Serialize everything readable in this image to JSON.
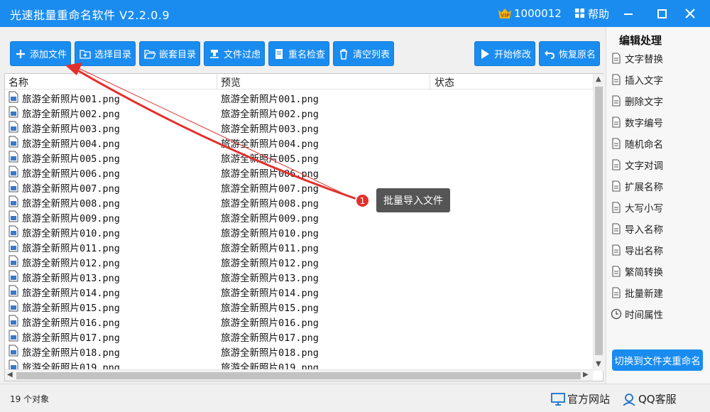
{
  "titlebar": {
    "title": "光速批量重命名软件 V2.2.0.9",
    "vip_number": "1000012",
    "help_label": "帮助"
  },
  "toolbar": {
    "add_files": "添加文件",
    "select_dir": "选择目录",
    "nested_dir": "嵌套目录",
    "file_filter": "文件过虑",
    "dup_check": "重名检查",
    "clear_list": "清空列表",
    "start": "开始修改",
    "restore": "恢复原名"
  },
  "list": {
    "columns": [
      "名称",
      "预览",
      "状态"
    ],
    "rows": [
      {
        "name": "旅游全新照片001.png",
        "preview": "旅游全新照片001.png"
      },
      {
        "name": "旅游全新照片002.png",
        "preview": "旅游全新照片002.png"
      },
      {
        "name": "旅游全新照片003.png",
        "preview": "旅游全新照片003.png"
      },
      {
        "name": "旅游全新照片004.png",
        "preview": "旅游全新照片004.png"
      },
      {
        "name": "旅游全新照片005.png",
        "preview": "旅游全新照片005.png"
      },
      {
        "name": "旅游全新照片006.png",
        "preview": "旅游全新照片006.png"
      },
      {
        "name": "旅游全新照片007.png",
        "preview": "旅游全新照片007.png"
      },
      {
        "name": "旅游全新照片008.png",
        "preview": "旅游全新照片008.png"
      },
      {
        "name": "旅游全新照片009.png",
        "preview": "旅游全新照片009.png"
      },
      {
        "name": "旅游全新照片010.png",
        "preview": "旅游全新照片010.png"
      },
      {
        "name": "旅游全新照片011.png",
        "preview": "旅游全新照片011.png"
      },
      {
        "name": "旅游全新照片012.png",
        "preview": "旅游全新照片012.png"
      },
      {
        "name": "旅游全新照片013.png",
        "preview": "旅游全新照片013.png"
      },
      {
        "name": "旅游全新照片014.png",
        "preview": "旅游全新照片014.png"
      },
      {
        "name": "旅游全新照片015.png",
        "preview": "旅游全新照片015.png"
      },
      {
        "name": "旅游全新照片016.png",
        "preview": "旅游全新照片016.png"
      },
      {
        "name": "旅游全新照片017.png",
        "preview": "旅游全新照片017.png"
      },
      {
        "name": "旅游全新照片018.png",
        "preview": "旅游全新照片018.png"
      },
      {
        "name": "旅游全新照片019.png",
        "preview": "旅游全新照片019.png"
      }
    ]
  },
  "side": {
    "title": "编辑处理",
    "items": [
      "文字替换",
      "插入文字",
      "删除文字",
      "数字编号",
      "随机命名",
      "文字对调",
      "扩展名称",
      "大写小写",
      "导入名称",
      "导出名称",
      "繁简转换",
      "批量新建",
      "时间属性"
    ],
    "switch_button": "切换到文件夹重命名"
  },
  "status": {
    "count": "19 个对象",
    "website": "官方网站",
    "qq": "QQ客服"
  },
  "annotation": {
    "badge": "1",
    "text": "批量导入文件"
  },
  "colors": {
    "accent": "#1a8cf0",
    "annotation_red": "#e2302b",
    "callout_bg": "#555555"
  }
}
